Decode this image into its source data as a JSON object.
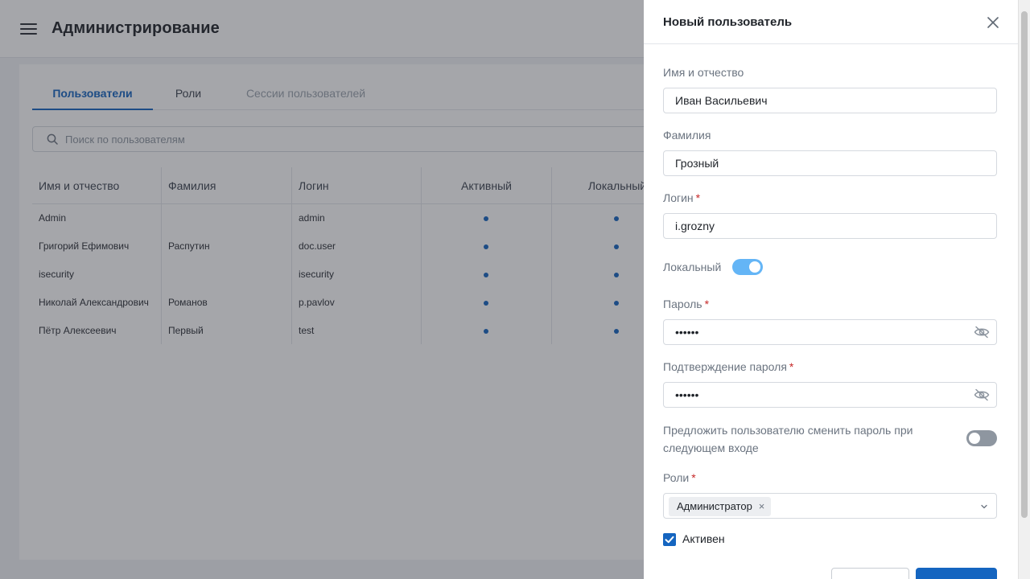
{
  "app": {
    "title": "Администрирование",
    "menu_icon": "hamburger-menu-icon"
  },
  "tabs": [
    {
      "label": "Пользователи",
      "state": "active"
    },
    {
      "label": "Роли",
      "state": "normal"
    },
    {
      "label": "Сессии пользователей",
      "state": "disabled"
    }
  ],
  "search": {
    "placeholder": "Поиск по пользователям",
    "value": "",
    "icon": "search-icon"
  },
  "table": {
    "headers": [
      "Имя и отчество",
      "Фамилия",
      "Логин",
      "Активный",
      "Локальный"
    ],
    "rows": [
      {
        "name": "Admin",
        "surname": "",
        "login": "admin",
        "active": true,
        "local": true
      },
      {
        "name": "Григорий Ефимович",
        "surname": "Распутин",
        "login": "doc.user",
        "active": true,
        "local": true
      },
      {
        "name": "isecurity",
        "surname": "",
        "login": "isecurity",
        "active": true,
        "local": true
      },
      {
        "name": "Николай Александрович",
        "surname": "Романов",
        "login": "p.pavlov",
        "active": true,
        "local": true
      },
      {
        "name": "Пётр Алексеевич",
        "surname": "Первый",
        "login": "test",
        "active": true,
        "local": true
      }
    ]
  },
  "drawer": {
    "title": "Новый пользователь",
    "close_icon": "close-icon",
    "fields": {
      "first_name": {
        "label": "Имя и отчество",
        "value": "Иван Васильевич",
        "required": false
      },
      "last_name": {
        "label": "Фамилия",
        "value": "Грозный",
        "required": false
      },
      "login": {
        "label": "Логин",
        "value": "i.grozny",
        "required": true
      },
      "password": {
        "label": "Пароль",
        "value": "••••••",
        "required": true,
        "icon": "eye-off-icon"
      },
      "password_confirm": {
        "label": "Подтверждение пароля",
        "value": "••••••",
        "required": true,
        "icon": "eye-off-icon"
      }
    },
    "local_toggle": {
      "label": "Локальный",
      "on": true
    },
    "change_password_toggle": {
      "label": "Предложить пользователю сменить пароль при следующем входе",
      "on": false
    },
    "roles": {
      "label": "Роли",
      "required": true,
      "selected": [
        "Администратор"
      ],
      "chip_remove": "×",
      "icon": "chevron-down-icon"
    },
    "active_checkbox": {
      "label": "Активен",
      "checked": true
    },
    "required_mark": "*"
  },
  "colors": {
    "accent": "#1565c0",
    "toggle_on": "#64b5f6",
    "toggle_off": "#8e96a0",
    "required": "#c62828"
  }
}
